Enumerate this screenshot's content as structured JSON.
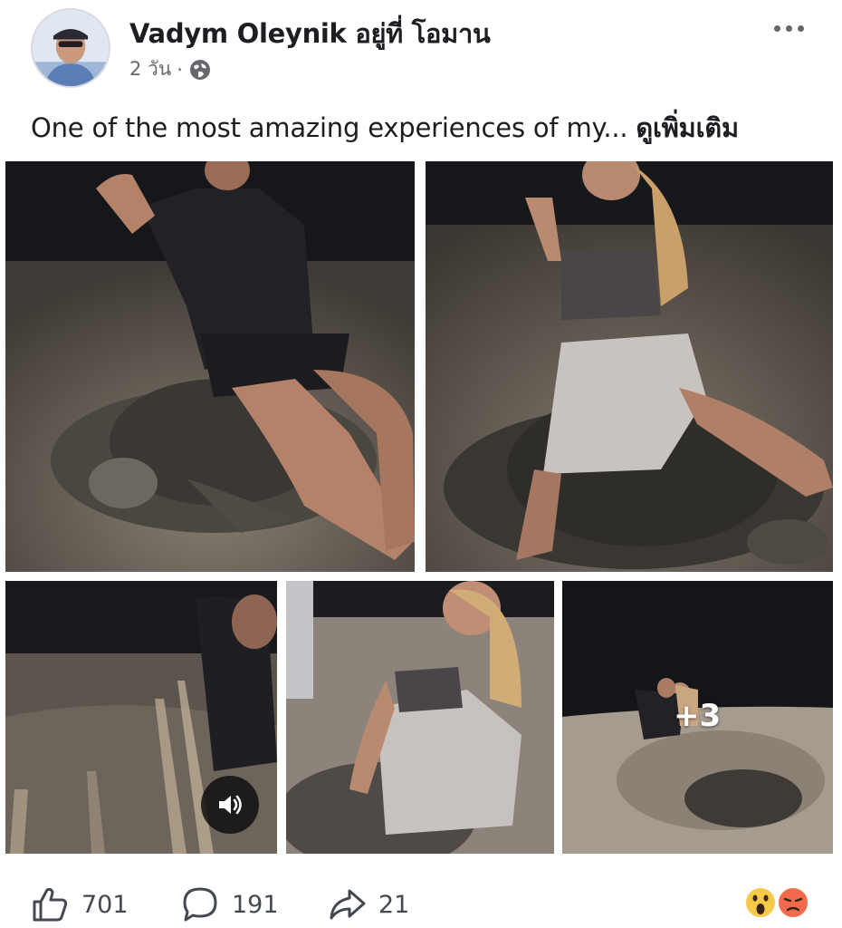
{
  "post": {
    "author": "Vadym Oleynik",
    "location_text": "อยู่ที่ โอมาน",
    "time": "2 วัน",
    "separator": "·",
    "privacy_icon": "globe-icon",
    "menu_icon": "more-options-icon"
  },
  "caption": {
    "text": "One of the most amazing experiences of my...",
    "see_more": "ดูเพิ่มเติม"
  },
  "photos": {
    "extra_count": "+3",
    "video_icon": "speaker-icon"
  },
  "actions": {
    "like_count": "701",
    "comment_count": "191",
    "share_count": "21"
  },
  "reactions": [
    "wow-reaction-icon",
    "angry-reaction-icon"
  ],
  "colors": {
    "muted_text": "#65676b",
    "night_sky": "#1a1b1e",
    "sand": "#6b6257"
  }
}
